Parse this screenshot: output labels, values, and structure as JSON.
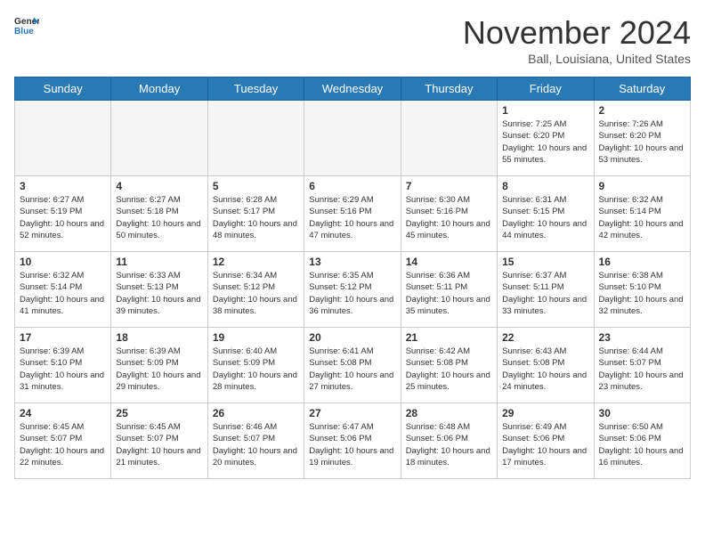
{
  "header": {
    "logo_line1": "General",
    "logo_line2": "Blue",
    "month": "November 2024",
    "location": "Ball, Louisiana, United States"
  },
  "days_of_week": [
    "Sunday",
    "Monday",
    "Tuesday",
    "Wednesday",
    "Thursday",
    "Friday",
    "Saturday"
  ],
  "weeks": [
    [
      {
        "day": "",
        "info": ""
      },
      {
        "day": "",
        "info": ""
      },
      {
        "day": "",
        "info": ""
      },
      {
        "day": "",
        "info": ""
      },
      {
        "day": "",
        "info": ""
      },
      {
        "day": "1",
        "info": "Sunrise: 7:25 AM\nSunset: 6:20 PM\nDaylight: 10 hours and 55 minutes."
      },
      {
        "day": "2",
        "info": "Sunrise: 7:26 AM\nSunset: 6:20 PM\nDaylight: 10 hours and 53 minutes."
      }
    ],
    [
      {
        "day": "3",
        "info": "Sunrise: 6:27 AM\nSunset: 5:19 PM\nDaylight: 10 hours and 52 minutes."
      },
      {
        "day": "4",
        "info": "Sunrise: 6:27 AM\nSunset: 5:18 PM\nDaylight: 10 hours and 50 minutes."
      },
      {
        "day": "5",
        "info": "Sunrise: 6:28 AM\nSunset: 5:17 PM\nDaylight: 10 hours and 48 minutes."
      },
      {
        "day": "6",
        "info": "Sunrise: 6:29 AM\nSunset: 5:16 PM\nDaylight: 10 hours and 47 minutes."
      },
      {
        "day": "7",
        "info": "Sunrise: 6:30 AM\nSunset: 5:16 PM\nDaylight: 10 hours and 45 minutes."
      },
      {
        "day": "8",
        "info": "Sunrise: 6:31 AM\nSunset: 5:15 PM\nDaylight: 10 hours and 44 minutes."
      },
      {
        "day": "9",
        "info": "Sunrise: 6:32 AM\nSunset: 5:14 PM\nDaylight: 10 hours and 42 minutes."
      }
    ],
    [
      {
        "day": "10",
        "info": "Sunrise: 6:32 AM\nSunset: 5:14 PM\nDaylight: 10 hours and 41 minutes."
      },
      {
        "day": "11",
        "info": "Sunrise: 6:33 AM\nSunset: 5:13 PM\nDaylight: 10 hours and 39 minutes."
      },
      {
        "day": "12",
        "info": "Sunrise: 6:34 AM\nSunset: 5:12 PM\nDaylight: 10 hours and 38 minutes."
      },
      {
        "day": "13",
        "info": "Sunrise: 6:35 AM\nSunset: 5:12 PM\nDaylight: 10 hours and 36 minutes."
      },
      {
        "day": "14",
        "info": "Sunrise: 6:36 AM\nSunset: 5:11 PM\nDaylight: 10 hours and 35 minutes."
      },
      {
        "day": "15",
        "info": "Sunrise: 6:37 AM\nSunset: 5:11 PM\nDaylight: 10 hours and 33 minutes."
      },
      {
        "day": "16",
        "info": "Sunrise: 6:38 AM\nSunset: 5:10 PM\nDaylight: 10 hours and 32 minutes."
      }
    ],
    [
      {
        "day": "17",
        "info": "Sunrise: 6:39 AM\nSunset: 5:10 PM\nDaylight: 10 hours and 31 minutes."
      },
      {
        "day": "18",
        "info": "Sunrise: 6:39 AM\nSunset: 5:09 PM\nDaylight: 10 hours and 29 minutes."
      },
      {
        "day": "19",
        "info": "Sunrise: 6:40 AM\nSunset: 5:09 PM\nDaylight: 10 hours and 28 minutes."
      },
      {
        "day": "20",
        "info": "Sunrise: 6:41 AM\nSunset: 5:08 PM\nDaylight: 10 hours and 27 minutes."
      },
      {
        "day": "21",
        "info": "Sunrise: 6:42 AM\nSunset: 5:08 PM\nDaylight: 10 hours and 25 minutes."
      },
      {
        "day": "22",
        "info": "Sunrise: 6:43 AM\nSunset: 5:08 PM\nDaylight: 10 hours and 24 minutes."
      },
      {
        "day": "23",
        "info": "Sunrise: 6:44 AM\nSunset: 5:07 PM\nDaylight: 10 hours and 23 minutes."
      }
    ],
    [
      {
        "day": "24",
        "info": "Sunrise: 6:45 AM\nSunset: 5:07 PM\nDaylight: 10 hours and 22 minutes."
      },
      {
        "day": "25",
        "info": "Sunrise: 6:45 AM\nSunset: 5:07 PM\nDaylight: 10 hours and 21 minutes."
      },
      {
        "day": "26",
        "info": "Sunrise: 6:46 AM\nSunset: 5:07 PM\nDaylight: 10 hours and 20 minutes."
      },
      {
        "day": "27",
        "info": "Sunrise: 6:47 AM\nSunset: 5:06 PM\nDaylight: 10 hours and 19 minutes."
      },
      {
        "day": "28",
        "info": "Sunrise: 6:48 AM\nSunset: 5:06 PM\nDaylight: 10 hours and 18 minutes."
      },
      {
        "day": "29",
        "info": "Sunrise: 6:49 AM\nSunset: 5:06 PM\nDaylight: 10 hours and 17 minutes."
      },
      {
        "day": "30",
        "info": "Sunrise: 6:50 AM\nSunset: 5:06 PM\nDaylight: 10 hours and 16 minutes."
      }
    ]
  ]
}
